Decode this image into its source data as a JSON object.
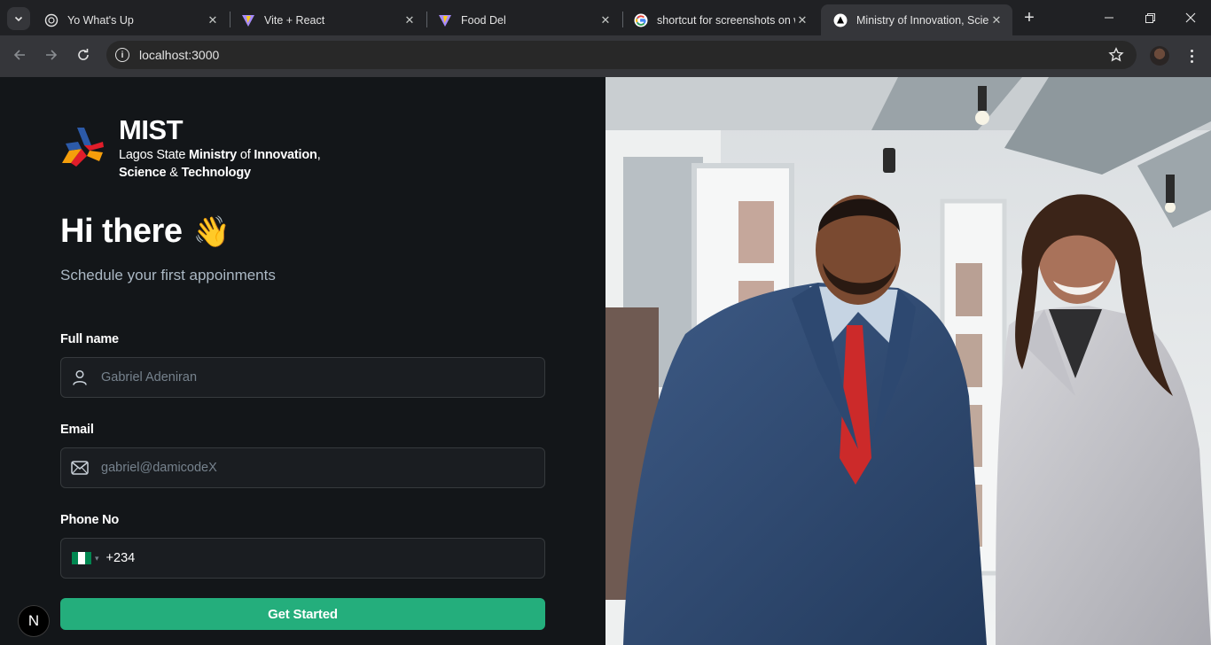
{
  "browser": {
    "tabs": [
      {
        "title": "Yo What's Up",
        "favicon": "openai-icon"
      },
      {
        "title": "Vite + React",
        "favicon": "vite-icon"
      },
      {
        "title": "Food Del",
        "favicon": "vite-icon"
      },
      {
        "title": "shortcut for screenshots on w",
        "favicon": "google-icon"
      },
      {
        "title": "Ministry of Innovation, Scien",
        "favicon": "nextjs-icon",
        "active": true
      }
    ],
    "address": "localhost:3000"
  },
  "brand": {
    "name": "MIST",
    "line1_a": "Lagos State ",
    "line1_b": "Ministry",
    "line1_c": " of ",
    "line1_d": "Innovation",
    "line1_e": ",",
    "line2_a": "Science",
    "line2_b": " & ",
    "line2_c": "Technology"
  },
  "hero": {
    "greeting": "Hi there",
    "emoji": "👋",
    "subtitle": "Schedule your first appoinments"
  },
  "form": {
    "name_label": "Full name",
    "name_placeholder": "Gabriel Adeniran",
    "email_label": "Email",
    "email_placeholder": "gabriel@damicodeX",
    "phone_label": "Phone No",
    "phone_value": "+234",
    "submit_label": "Get Started"
  },
  "badge": "N",
  "colors": {
    "accent": "#24ae7c",
    "background": "#131619",
    "input_bg": "#1a1d21",
    "input_border": "#363a3d"
  }
}
